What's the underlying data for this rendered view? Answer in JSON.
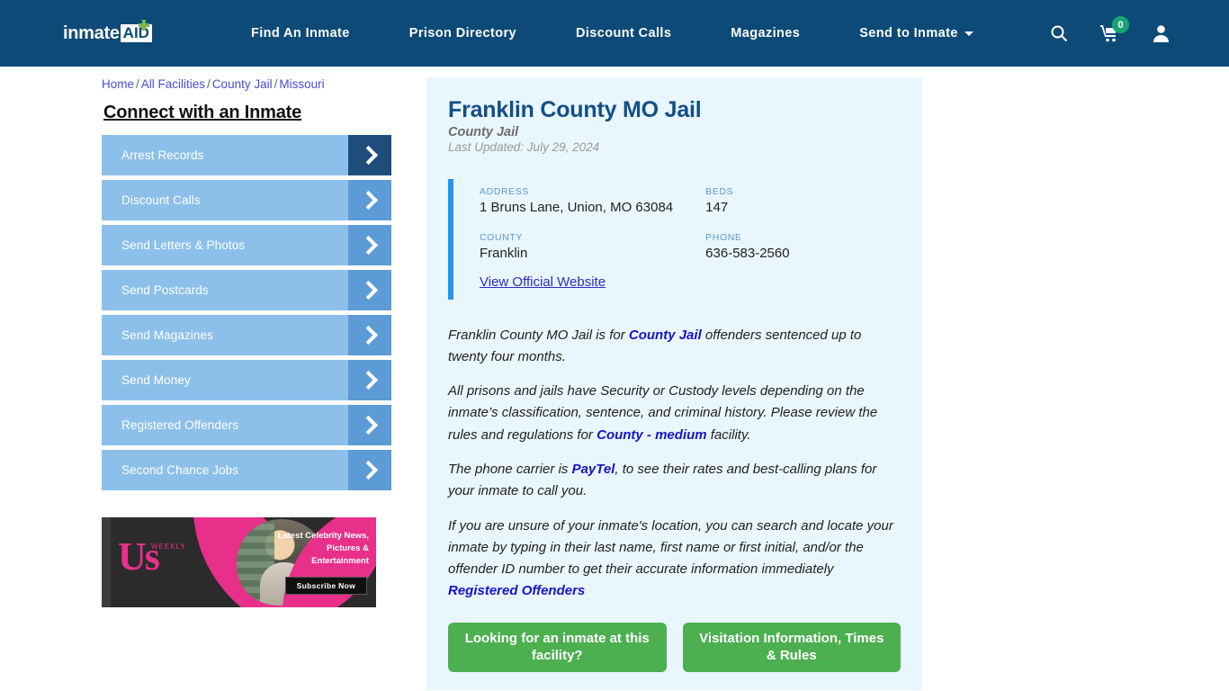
{
  "header": {
    "logo": {
      "word": "inmate",
      "badge": "AID",
      "cross_icon": "green-plus-icon"
    },
    "nav": [
      {
        "label": "Find An Inmate",
        "caret": false
      },
      {
        "label": "Prison Directory",
        "caret": false
      },
      {
        "label": "Discount Calls",
        "caret": false
      },
      {
        "label": "Magazines",
        "caret": false
      },
      {
        "label": "Send to Inmate",
        "caret": true
      }
    ],
    "icons": {
      "search": "search-icon",
      "cart": "shopping-cart-icon",
      "cart_count": "0",
      "account": "user-account-icon"
    },
    "colors": {
      "bar": "#0d4a77",
      "badge": "#17a673"
    }
  },
  "breadcrumb": {
    "items": [
      "Home",
      "All Facilities",
      "County Jail",
      "Missouri"
    ],
    "separator": "/"
  },
  "sidebar": {
    "title": "Connect with an Inmate",
    "items": [
      {
        "label": "Arrest Records",
        "active": true
      },
      {
        "label": "Discount Calls",
        "active": false
      },
      {
        "label": "Send Letters & Photos",
        "active": false
      },
      {
        "label": "Send Postcards",
        "active": false
      },
      {
        "label": "Send Magazines",
        "active": false
      },
      {
        "label": "Send Money",
        "active": false
      },
      {
        "label": "Registered Offenders",
        "active": false
      },
      {
        "label": "Second Chance Jobs",
        "active": false
      }
    ],
    "arrow_icon": "chevron-right-icon"
  },
  "ad": {
    "brand": "Us",
    "brand_sub": "WEEKLY",
    "headline": "Latest Celebrity News, Pictures & Entertainment",
    "cta": "Subscribe Now"
  },
  "facility": {
    "title": "Franklin County MO Jail",
    "subtitle": "County Jail",
    "last_updated": "Last Updated: July 29, 2024",
    "info": {
      "address_label": "ADDRESS",
      "address_value": "1 Bruns Lane, Union, MO 63084",
      "beds_label": "BEDS",
      "beds_value": "147",
      "county_label": "COUNTY",
      "county_value": "Franklin",
      "phone_label": "PHONE",
      "phone_value": "636-583-2560",
      "website_link": "View Official Website"
    },
    "paragraphs": {
      "p1_a": "Franklin County MO Jail is for ",
      "p1_link": "County Jail",
      "p1_b": " offenders sentenced up to twenty four months.",
      "p2_a": "All prisons and jails have Security or Custody levels depending on the inmate’s classification, sentence, and criminal history. Please review the rules and regulations for ",
      "p2_link": "County - medium",
      "p2_b": " facility.",
      "p3_a": "The phone carrier is ",
      "p3_link": "PayTel",
      "p3_b": ", to see their rates and best-calling plans for your inmate to call you.",
      "p4_a": "If you are unsure of your inmate's location, you can search and locate your inmate by typing in their last name, first name or first initial, and/or the offender ID number to get their accurate information immediately ",
      "p4_link": "Registered Offenders"
    },
    "cta_buttons": [
      {
        "label": "Looking for an inmate at this facility?"
      },
      {
        "label": "Visitation Information, Times & Rules"
      }
    ]
  },
  "colors": {
    "header_blue": "#0d4a77",
    "panel_blue": "#e9f6fd",
    "accent_blue": "#2196f3",
    "sidebar_blue": "#8cc0ea",
    "arrow_blue": "#5c9bd5",
    "arrow_active": "#1e4d7b",
    "link_blue": "#1515c7",
    "green": "#4caf50",
    "ad_pink": "#e8308a"
  }
}
